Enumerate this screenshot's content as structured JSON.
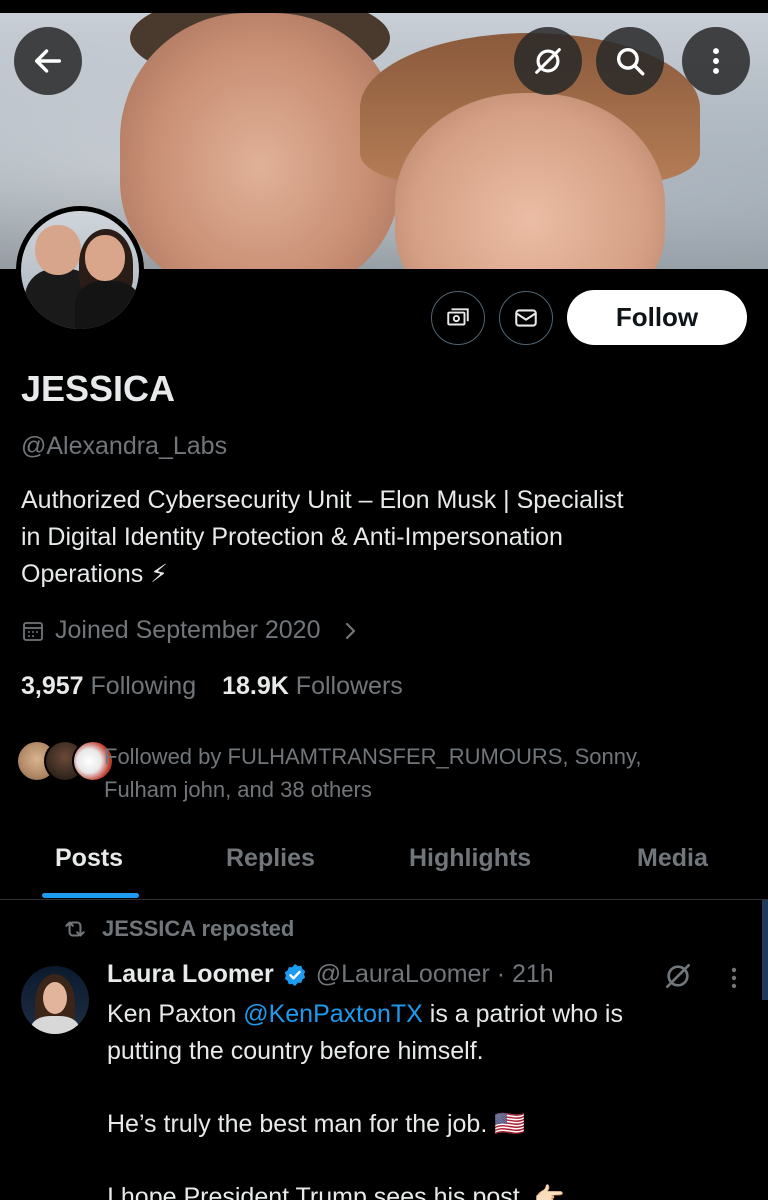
{
  "header": {
    "back_icon": "arrow-left-icon",
    "grok_icon": "grok-icon",
    "search_icon": "search-icon",
    "more_icon": "more-vertical-icon"
  },
  "profile": {
    "name": "JESSICA",
    "handle": "@Alexandra_Labs",
    "bio_lines": [
      "Authorized Cybersecurity Unit – Elon Musk | Specialist",
      "in Digital Identity Protection & Anti-Impersonation",
      "Operations ⚡"
    ],
    "joined": "Joined September 2020",
    "following_count": "3,957",
    "following_label": "Following",
    "followers_count": "18.9K",
    "followers_label": "Followers",
    "followed_by_line1": "Followed by FULHAMTRANSFER_RUMOURS, Sonny,",
    "followed_by_line2": "Fulham john, and 38 others",
    "follow_label": "Follow"
  },
  "tabs": [
    {
      "label": "Posts",
      "active": true
    },
    {
      "label": "Replies",
      "active": false
    },
    {
      "label": "Highlights",
      "active": false
    },
    {
      "label": "Media",
      "active": false
    }
  ],
  "post": {
    "repost_label": "JESSICA reposted",
    "author_name": "Laura Loomer",
    "author_meta": "@LauraLoomer · 21h",
    "text_line1_prefix": "Ken Paxton ",
    "text_line1_mention": "@KenPaxtonTX",
    "text_line1_suffix": " is a patriot who is",
    "text_line2": "putting the country before himself.",
    "text_line3": "He’s truly the best man for the job. 🇺🇸",
    "text_line4": "I hope President Trump sees his post. 👉🏻"
  },
  "colors": {
    "accent": "#1d9bf0",
    "background": "#000000",
    "muted": "#71767b",
    "text": "#e7e9ea"
  }
}
